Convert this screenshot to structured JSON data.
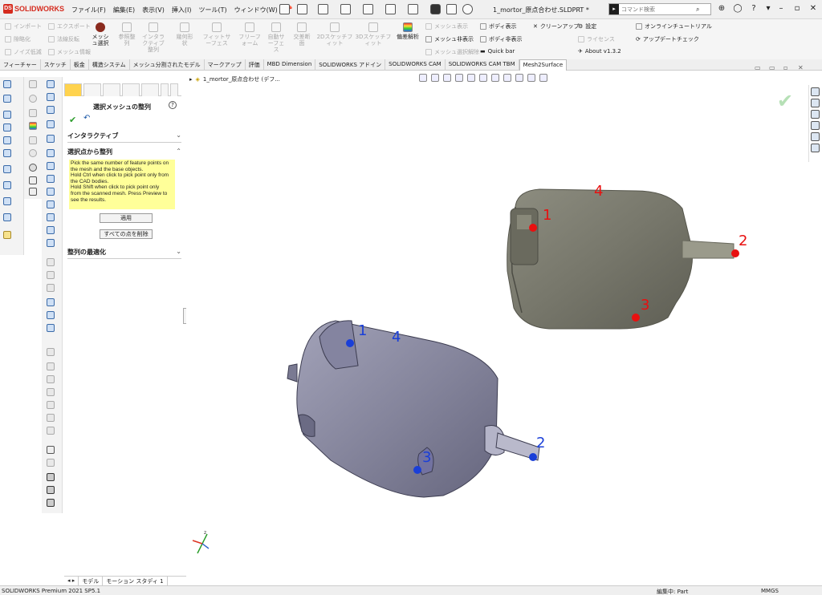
{
  "app": {
    "logo_text": "SOLIDWORKS",
    "title": "1_mortor_原点合わせ.SLDPRT *",
    "menus": [
      "ファイル(F)",
      "編集(E)",
      "表示(V)",
      "挿入(I)",
      "ツール(T)",
      "ウィンドウ(W)"
    ],
    "search_placeholder": "コマンド検索"
  },
  "ribbon": {
    "col1": [
      "インポート",
      "隙略化",
      "ノイズ低減"
    ],
    "col2": [
      "エクスポート",
      "法線反転",
      "メッシュ情報"
    ],
    "mesh_select": "メッシュ選択",
    "disabled_big": [
      "参照整列",
      "インタラクティブ整列",
      "幾何形状",
      "フィットサーフェス",
      "フリーフォーム",
      "自動サーフェス",
      "交差断面",
      "2Dスケッチフィット",
      "3Dスケッチフィット"
    ],
    "deviation": "偏差解析",
    "mesh_show": "メッシュ表示",
    "mesh_hide": "メッシュ非表示",
    "mesh_deselect": "メッシュ選択解除",
    "body_show": "ボディ表示",
    "body_hide": "ボディ非表示",
    "quick_bar": "Quick bar",
    "clearup": "クリーンアップ",
    "license": "ライセンス",
    "settings": "設定",
    "about": "About v1.3.2",
    "tutorial": "オンラインチュートリアル",
    "update": "アップデートチェック"
  },
  "tabs": [
    "フィーチャー",
    "スケッチ",
    "板金",
    "構造システム",
    "メッシュ分割されたモデル",
    "マークアップ",
    "評価",
    "MBD Dimension",
    "SOLIDWORKS アドイン",
    "SOLIDWORKS CAM",
    "SOLIDWORKS CAM TBM",
    "Mesh2Surface"
  ],
  "active_tab": "Mesh2Surface",
  "property_manager": {
    "title": "選択メッシュの整列",
    "help": "?",
    "group1": "インタラクティブ",
    "group2": "選択点から整列",
    "message": "Pick the same number of feature points on\nthe mesh and the base objects.\nHold Ctrl when click to pick point only from\nthe CAD bodies.\nHold Shift when click to pick point only\nfrom the scanned mesh. Press Preview to\nsee the results.",
    "apply": "適用",
    "delete_all": "すべての点を削除",
    "group3": "整列の最適化"
  },
  "feature_tree": "1_mortor_原点合わせ (デフ...",
  "bottom_tabs": [
    "モデル",
    "モーション スタディ 1"
  ],
  "status": {
    "product": "SOLIDWORKS Premium 2021 SP5.1",
    "mode": "編集中: Part",
    "units": "MMGS"
  },
  "markers": {
    "mesh": [
      "1",
      "2",
      "3",
      "4"
    ],
    "cad": [
      "1",
      "2",
      "3",
      "4"
    ],
    "mesh_color": "#e81010",
    "cad_color": "#1a3fd8"
  }
}
